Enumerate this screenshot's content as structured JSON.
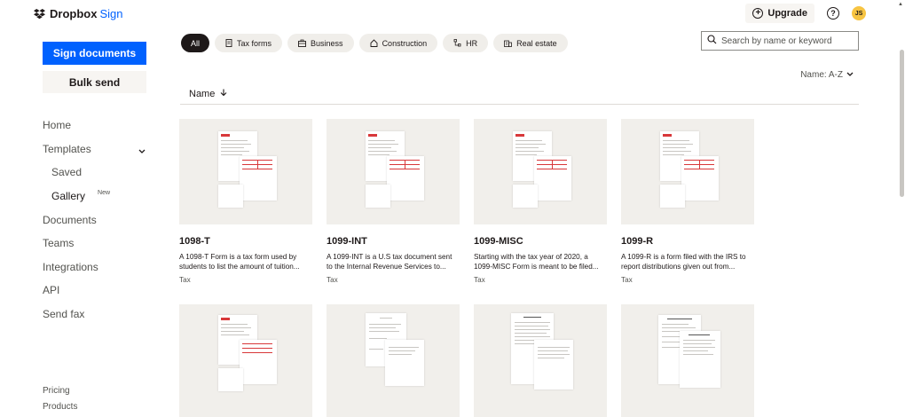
{
  "brand": {
    "name": "Dropbox",
    "product": "Sign"
  },
  "header": {
    "upgrade_label": "Upgrade",
    "avatar_initials": "JS"
  },
  "sidebar": {
    "sign_documents": "Sign documents",
    "bulk_send": "Bulk send",
    "items": [
      {
        "label": "Home"
      },
      {
        "label": "Templates"
      },
      {
        "label": "Saved"
      },
      {
        "label": "Gallery",
        "badge": "New"
      },
      {
        "label": "Documents"
      },
      {
        "label": "Teams"
      },
      {
        "label": "Integrations"
      },
      {
        "label": "API"
      },
      {
        "label": "Send fax"
      }
    ],
    "bottom": [
      {
        "label": "Pricing"
      },
      {
        "label": "Products"
      }
    ]
  },
  "filters": [
    "All",
    "Tax forms",
    "Business",
    "Construction",
    "HR",
    "Real estate"
  ],
  "search": {
    "placeholder": "Search by name or keyword"
  },
  "sort": {
    "label": "Name: A-Z"
  },
  "column": {
    "name": "Name"
  },
  "templates": [
    {
      "title": "1098-T",
      "desc": "A 1098-T Form is a tax form used by students to list the amount of tuition...",
      "tag": "Tax"
    },
    {
      "title": "1099-INT",
      "desc": "A 1099-INT is a U.S tax document sent to the Internal Revenue Services to...",
      "tag": "Tax"
    },
    {
      "title": "1099-MISC",
      "desc": "Starting with the tax year of 2020, a 1099-MISC Form is meant to be filed...",
      "tag": "Tax"
    },
    {
      "title": "1099-R",
      "desc": "A 1099-R is a form filed with the IRS to report distributions given out from...",
      "tag": "Tax"
    }
  ],
  "colors": {
    "accent": "#0061fe",
    "text": "#1e1919",
    "card_bg": "#f1efeb",
    "chip_bg": "#f0eeea"
  }
}
